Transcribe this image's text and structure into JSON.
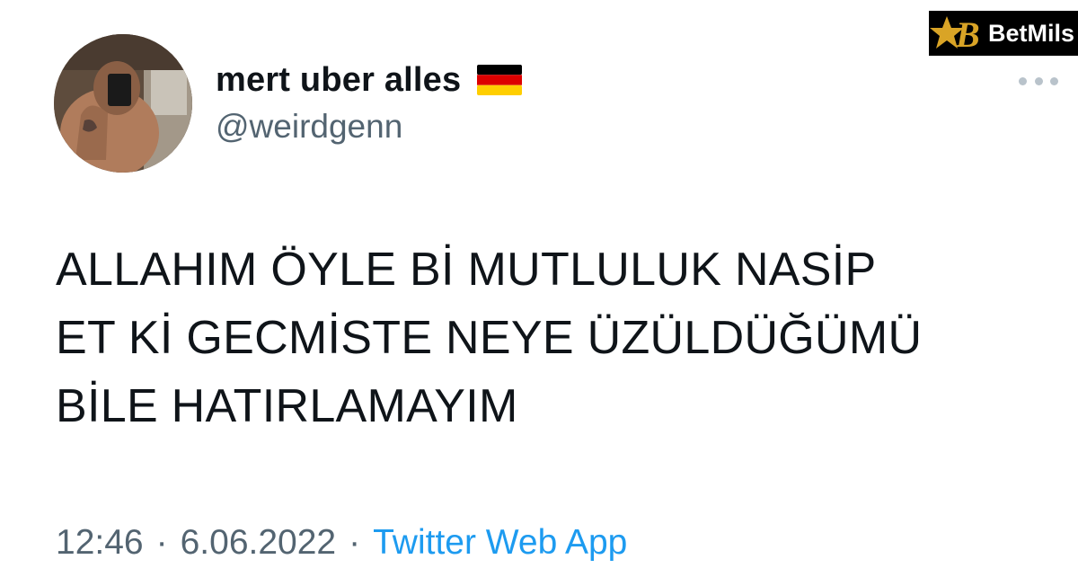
{
  "tweet": {
    "author": {
      "display_name": "mert uber alles",
      "flag_icon": "germany-flag-icon",
      "handle": "@weirdgenn",
      "avatar_icon": "profile-photo"
    },
    "text": "ALLAHIM ÖYLE Bİ MUTLULUK NASİP\nET Kİ GECMİSTE NEYE ÜZÜLDÜĞÜMÜ\nBİLE HATIRLAMAYIM",
    "time": "12:46",
    "separator": "·",
    "date": "6.06.2022",
    "source": "Twitter Web App",
    "more_icon": "more-options-icon"
  },
  "watermark": {
    "brand": "BetMils",
    "colors": {
      "background": "#000000",
      "gold": "#d9a426",
      "text": "#ffffff"
    }
  },
  "colors": {
    "text": "#0f1419",
    "muted": "#536471",
    "link": "#1d9bf0"
  }
}
